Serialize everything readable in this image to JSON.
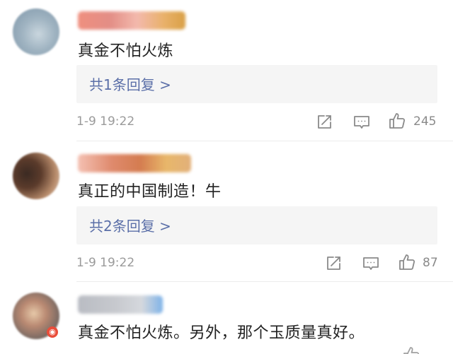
{
  "comments": [
    {
      "text": "真金不怕火炼",
      "replies_label": "共1条回复 >",
      "time": "1-9 19:22",
      "likes": "245"
    },
    {
      "text": "真正的中国制造！牛",
      "replies_label": "共2条回复 >",
      "time": "1-9 19:22",
      "likes": "87"
    },
    {
      "text": "真金不怕火炼。另外，那个玉质量真好。"
    }
  ],
  "icons": {
    "share": "share-icon",
    "comment": "comment-icon",
    "like": "thumbs-up-icon",
    "badge": "weibo-badge-icon"
  },
  "colors": {
    "link": "#5b6fa8",
    "meta": "#9a9a9a",
    "text": "#222222",
    "badge": "#e94d3a"
  }
}
